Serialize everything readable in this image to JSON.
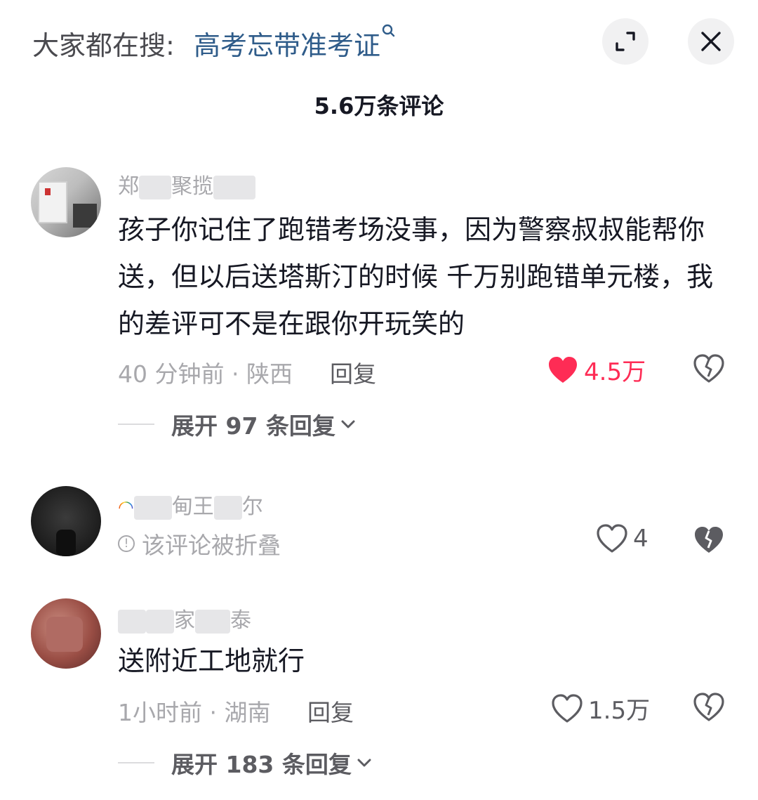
{
  "search": {
    "prefix": "大家都在搜:",
    "term": "高考忘带准考证"
  },
  "header": {
    "title": "5.6万条评论"
  },
  "comments": [
    {
      "username_visible": "郑",
      "username_mid": "聚揽",
      "text": "孩子你记住了跑错考场没事，因为警察叔叔能帮你送，但以后送塔斯汀的时候 千万别跑错单元楼，我的差评可不是在跟你开玩笑的",
      "meta": "40 分钟前 · 陕西",
      "reply_label": "回复",
      "likes": "4.5万",
      "liked": true,
      "expand_label": "展开 97 条回复"
    },
    {
      "username_visible": "甸王",
      "username_mid": "尔",
      "folded_text": "该评论被折叠",
      "likes": "4",
      "liked": false
    },
    {
      "username_visible": "家",
      "username_mid": "泰",
      "text": "送附近工地就行",
      "meta": "1小时前 · 湖南",
      "reply_label": "回复",
      "likes": "1.5万",
      "liked": false,
      "expand_label": "展开 183 条回复"
    }
  ],
  "colors": {
    "like_red": "#fe2c55",
    "link_blue": "#2f5c8a",
    "muted": "#a8a8ac"
  },
  "icons": [
    "search-icon",
    "collapse-icon",
    "close-icon",
    "heart-icon",
    "broken-heart-icon",
    "chevron-down-icon",
    "info-icon"
  ]
}
